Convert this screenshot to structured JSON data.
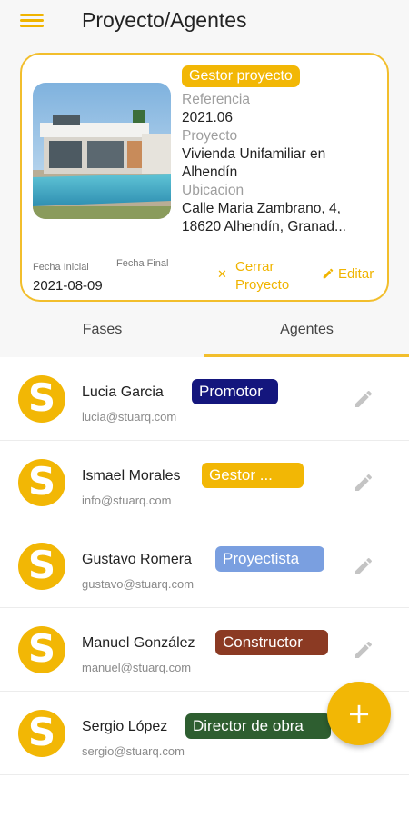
{
  "header": {
    "title": "Proyecto/Agentes",
    "menu_icon": "hamburger-icon"
  },
  "project": {
    "role": "Gestor proyecto",
    "referencia_label": "Referencia",
    "referencia": "2021.06",
    "proyecto_label": "Proyecto",
    "proyecto": "Vivienda Unifamiliar en Alhendín",
    "ubicacion_label": "Ubicacion",
    "ubicacion": "Calle Maria Zambrano, 4, 18620 Alhendín, Granad...",
    "fecha_inicial_label": "Fecha Inicial",
    "fecha_inicial": "2021-08-09",
    "fecha_final_label": "Fecha Final",
    "close_label": "Cerrar Proyecto",
    "edit_label": "Editar"
  },
  "tabs": [
    {
      "label": "Fases",
      "active": false
    },
    {
      "label": "Agentes",
      "active": true
    }
  ],
  "agents": [
    {
      "name": "Lucia Garcia",
      "email": "lucia@stuarq.com",
      "role": "Promotor",
      "role_color": "#14167d"
    },
    {
      "name": "Ismael Morales",
      "email": "info@stuarq.com",
      "role": "Gestor ...",
      "role_color": "#f2b705"
    },
    {
      "name": "Gustavo Romera",
      "email": "gustavo@stuarq.com",
      "role": "Proyectista",
      "role_color": "#7a9fe0"
    },
    {
      "name": "Manuel González",
      "email": "manuel@stuarq.com",
      "role": "Constructor",
      "role_color": "#8b3a23"
    },
    {
      "name": "Sergio López",
      "email": "sergio@stuarq.com",
      "role": "Director de obra",
      "role_color": "#2e5e30"
    }
  ],
  "avatar_letter": "S",
  "fab_icon": "plus-icon",
  "colors": {
    "accent": "#f2b705",
    "border": "#f2be2c"
  }
}
